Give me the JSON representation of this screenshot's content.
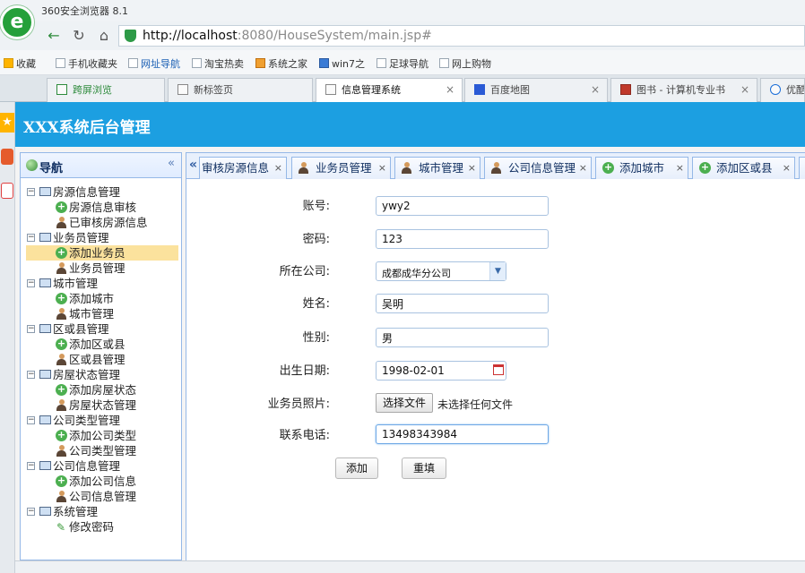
{
  "browser": {
    "title": "360安全浏览器 8.1",
    "logo": "e",
    "url_host": "http://localhost",
    "url_path": ":8080/HouseSystem/main.jsp#"
  },
  "bookmarks": [
    {
      "label": "收藏",
      "icon": "star-icon"
    },
    {
      "label": "手机收藏夹",
      "icon": "phone-icon"
    },
    {
      "label": "网址导航",
      "icon": "page-icon"
    },
    {
      "label": "淘宝热卖",
      "icon": "page-icon"
    },
    {
      "label": "系统之家",
      "icon": "windows-icon"
    },
    {
      "label": "win7之",
      "icon": "bird-icon"
    },
    {
      "label": "足球导航",
      "icon": "page-icon"
    },
    {
      "label": "网上购物",
      "icon": "page-icon"
    }
  ],
  "browser_tabs": [
    {
      "label": "跨屏浏览"
    },
    {
      "label": "新标签页"
    },
    {
      "label": "信息管理系统"
    },
    {
      "label": "百度地图"
    },
    {
      "label": "图书 - 计算机专业书"
    },
    {
      "label": "优酷"
    }
  ],
  "app": {
    "title": "XXX系统后台管理"
  },
  "nav": {
    "title": "导航",
    "collapse_glyph": "«",
    "groups": [
      {
        "label": "房源信息管理",
        "items": [
          {
            "label": "房源信息审核",
            "icon": "add-icon"
          },
          {
            "label": "已审核房源信息",
            "icon": "user-icon"
          }
        ]
      },
      {
        "label": "业务员管理",
        "items": [
          {
            "label": "添加业务员",
            "icon": "add-icon"
          },
          {
            "label": "业务员管理",
            "icon": "user-icon"
          }
        ]
      },
      {
        "label": "城市管理",
        "items": [
          {
            "label": "添加城市",
            "icon": "add-icon"
          },
          {
            "label": "城市管理",
            "icon": "user-icon"
          }
        ]
      },
      {
        "label": "区或县管理",
        "items": [
          {
            "label": "添加区或县",
            "icon": "add-icon"
          },
          {
            "label": "区或县管理",
            "icon": "user-icon"
          }
        ]
      },
      {
        "label": "房屋状态管理",
        "items": [
          {
            "label": "添加房屋状态",
            "icon": "add-icon"
          },
          {
            "label": "房屋状态管理",
            "icon": "user-icon"
          }
        ]
      },
      {
        "label": "公司类型管理",
        "items": [
          {
            "label": "添加公司类型",
            "icon": "add-icon"
          },
          {
            "label": "公司类型管理",
            "icon": "user-icon"
          }
        ]
      },
      {
        "label": "公司信息管理",
        "items": [
          {
            "label": "添加公司信息",
            "icon": "add-icon"
          },
          {
            "label": "公司信息管理",
            "icon": "user-icon"
          }
        ]
      },
      {
        "label": "系统管理",
        "items": [
          {
            "label": "修改密码",
            "icon": "pencil-icon"
          }
        ]
      }
    ]
  },
  "content_tabs": [
    {
      "label": "审核房源信息",
      "icon": "none"
    },
    {
      "label": "业务员管理",
      "icon": "user-icon"
    },
    {
      "label": "城市管理",
      "icon": "user-icon"
    },
    {
      "label": "公司信息管理",
      "icon": "user-icon"
    },
    {
      "label": "添加城市",
      "icon": "add-icon"
    },
    {
      "label": "添加区或县",
      "icon": "add-icon"
    }
  ],
  "form": {
    "account_label": "账号:",
    "account_value": "ywy2",
    "password_label": "密码:",
    "password_value": "123",
    "company_label": "所在公司:",
    "company_value": "成都成华分公司",
    "name_label": "姓名:",
    "name_value": "吴明",
    "gender_label": "性别:",
    "gender_value": "男",
    "birth_label": "出生日期:",
    "birth_value": "1998-02-01",
    "photo_label": "业务员照片:",
    "photo_button": "选择文件",
    "photo_status": "未选择任何文件",
    "phone_label": "联系电话:",
    "phone_value": "13498343984",
    "submit_label": "添加",
    "reset_label": "重填"
  }
}
